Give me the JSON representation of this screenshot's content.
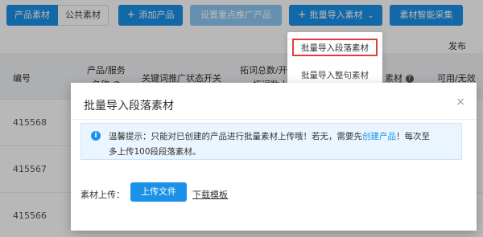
{
  "toolbar": {
    "tabs": [
      "产品素材",
      "公共素材"
    ],
    "add_product": "添加产品",
    "set_key_product": "设置重点推广产品",
    "batch_import": "批量导入素材",
    "smart_collect": "素材智能采集"
  },
  "dropdown": {
    "items": [
      "批量导入段落素材",
      "批量导入整句素材"
    ]
  },
  "right_label": "发布",
  "table": {
    "headers": {
      "id": "编号",
      "product_service": "产品/服务",
      "product_service_line2": "名称",
      "keyword_switch": "关键词推广状态开关",
      "expand_total": "拓词总数/开始",
      "expand_total_line2": "拓词数人",
      "material": "素材",
      "available": "可用/无效"
    },
    "rows": [
      {
        "id": "415568"
      },
      {
        "id": "415567"
      },
      {
        "id": "415566"
      }
    ]
  },
  "modal": {
    "title": "批量导入段落素材",
    "close": "×",
    "alert": {
      "prefix": "温馨提示：只能对已创建的产品进行批量素材上传哦！若无，需要先",
      "link": "创建产品",
      "suffix": "！每次至",
      "line2": "多上传100段段落素材。"
    },
    "upload_label": "素材上传：",
    "upload_button": "上传文件",
    "download_template": "下载模板"
  }
}
